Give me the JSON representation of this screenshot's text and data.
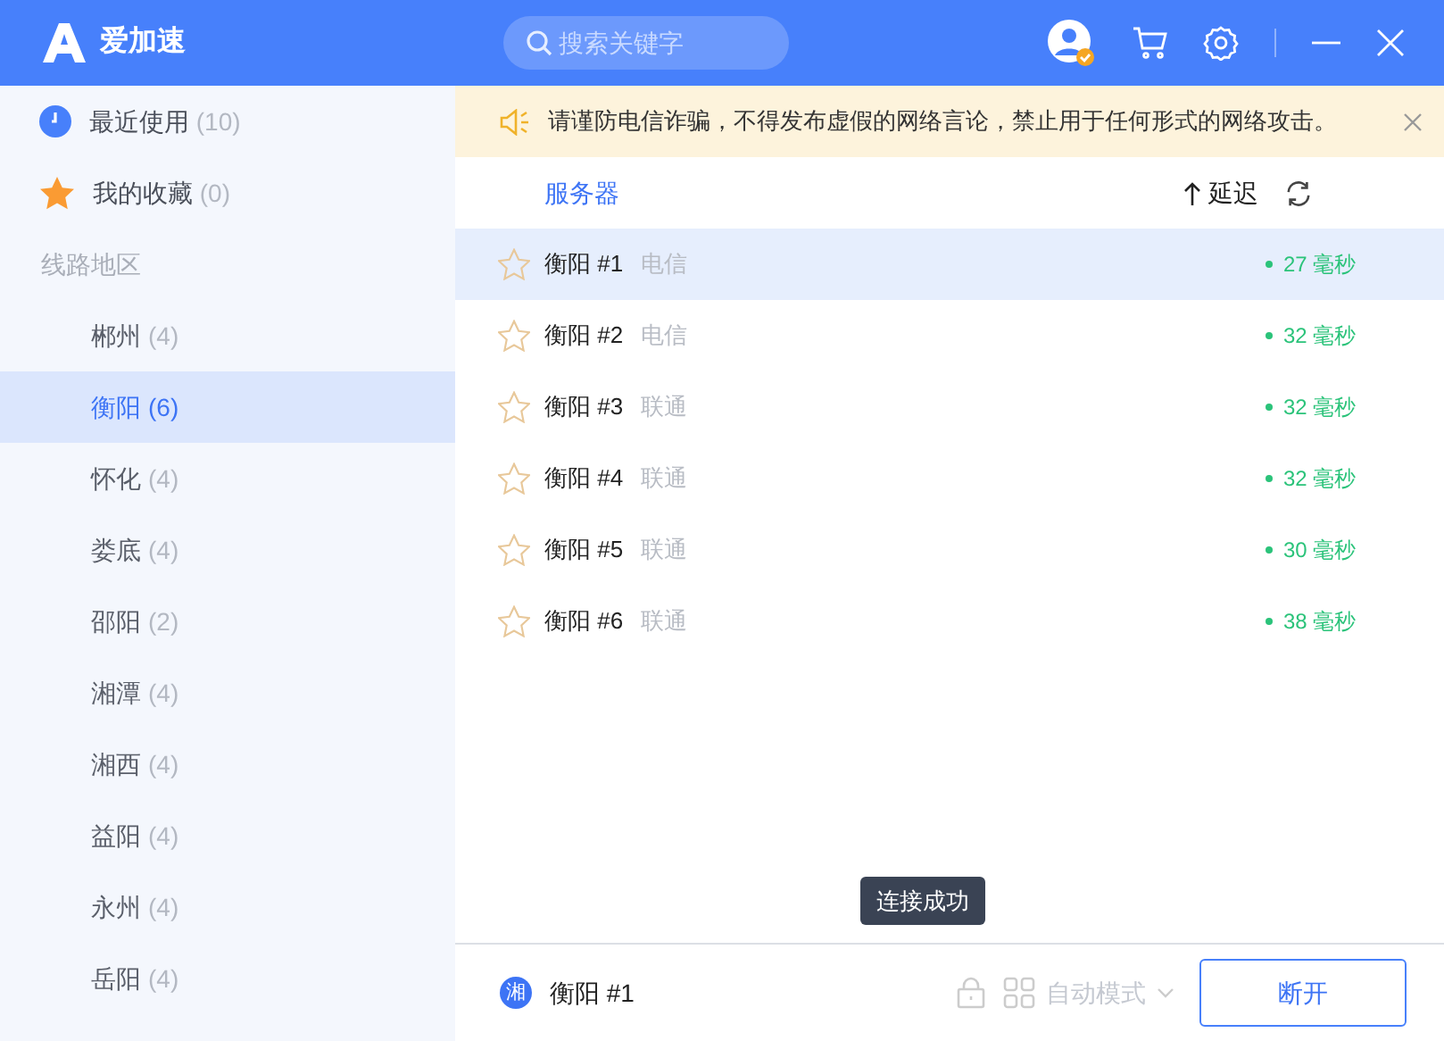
{
  "app": {
    "title": "爱加速"
  },
  "search": {
    "placeholder": "搜索关键字"
  },
  "sidebar": {
    "items": [
      {
        "kind": "clock",
        "label": "最近使用",
        "count": "(10)"
      },
      {
        "kind": "star",
        "label": "我的收藏",
        "count": "(0)"
      }
    ],
    "section_title": "线路地区",
    "regions": [
      {
        "label": "郴州",
        "count": "(4)",
        "selected": false
      },
      {
        "label": "衡阳",
        "count": "(6)",
        "selected": true
      },
      {
        "label": "怀化",
        "count": "(4)",
        "selected": false
      },
      {
        "label": "娄底",
        "count": "(4)",
        "selected": false
      },
      {
        "label": "邵阳",
        "count": "(2)",
        "selected": false
      },
      {
        "label": "湘潭",
        "count": "(4)",
        "selected": false
      },
      {
        "label": "湘西",
        "count": "(4)",
        "selected": false
      },
      {
        "label": "益阳",
        "count": "(4)",
        "selected": false
      },
      {
        "label": "永州",
        "count": "(4)",
        "selected": false
      },
      {
        "label": "岳阳",
        "count": "(4)",
        "selected": false
      }
    ]
  },
  "notice": {
    "text": "请谨防电信诈骗，不得发布虚假的网络言论，禁止用于任何形式的网络攻击。"
  },
  "table": {
    "columns": [
      {
        "label": "服务器"
      },
      {
        "label": "延迟"
      }
    ],
    "rows": [
      {
        "name": "衡阳 #1",
        "isp": "电信",
        "latency": "27 毫秒",
        "selected": true
      },
      {
        "name": "衡阳 #2",
        "isp": "电信",
        "latency": "32 毫秒",
        "selected": false
      },
      {
        "name": "衡阳 #3",
        "isp": "联通",
        "latency": "32 毫秒",
        "selected": false
      },
      {
        "name": "衡阳 #4",
        "isp": "联通",
        "latency": "32 毫秒",
        "selected": false
      },
      {
        "name": "衡阳 #5",
        "isp": "联通",
        "latency": "30 毫秒",
        "selected": false
      },
      {
        "name": "衡阳 #6",
        "isp": "联通",
        "latency": "38 毫秒",
        "selected": false
      }
    ]
  },
  "tooltip": {
    "text": "连接成功"
  },
  "footer": {
    "badge": "湘",
    "server": "衡阳 #1",
    "mode": "自动模式",
    "button": "断开"
  }
}
